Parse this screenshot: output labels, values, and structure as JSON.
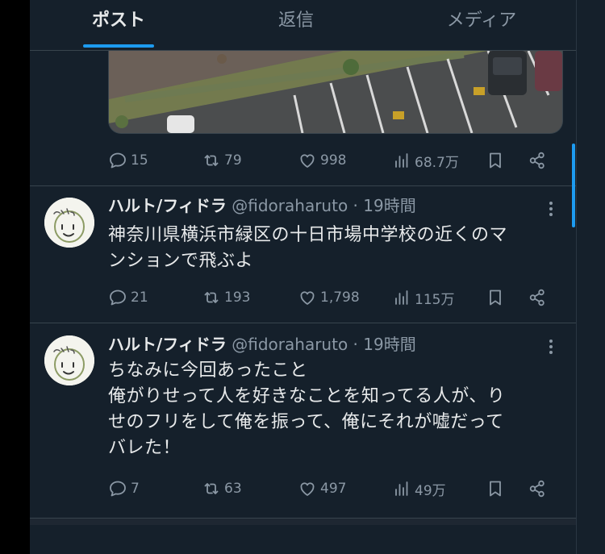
{
  "tabs": [
    {
      "label": "ポスト"
    },
    {
      "label": "返信"
    },
    {
      "label": "メディア"
    }
  ],
  "colors": {
    "accent": "#1d9bf0",
    "background": "#15202b",
    "muted": "#8b98a5",
    "text": "#e7e9ea"
  },
  "posts": [
    {
      "stats": {
        "replies": "15",
        "reposts": "79",
        "likes": "998",
        "views": "68.7万"
      }
    },
    {
      "name": "ハルト/フィドラ",
      "handle": "@fidoraharuto",
      "time": "· 19時間",
      "lines": [
        "神奈川県横浜市緑区の十日市場中学校の近くのマ",
        "ンションで飛ぶよ"
      ],
      "stats": {
        "replies": "21",
        "reposts": "193",
        "likes": "1,798",
        "views": "115万"
      }
    },
    {
      "name": "ハルト/フィドラ",
      "handle": "@fidoraharuto",
      "time": "· 19時間",
      "lines": [
        "ちなみに今回あったこと",
        "俺がりせって人を好きなことを知ってる人が、り",
        "せのフリをして俺を振って、俺にそれが嘘だって",
        "バレた！"
      ],
      "stats": {
        "replies": "7",
        "reposts": "63",
        "likes": "497",
        "views": "49万"
      }
    }
  ],
  "icons": [
    "reply-icon",
    "repost-icon",
    "like-icon",
    "views-icon",
    "bookmark-icon",
    "share-icon",
    "more-icon"
  ]
}
